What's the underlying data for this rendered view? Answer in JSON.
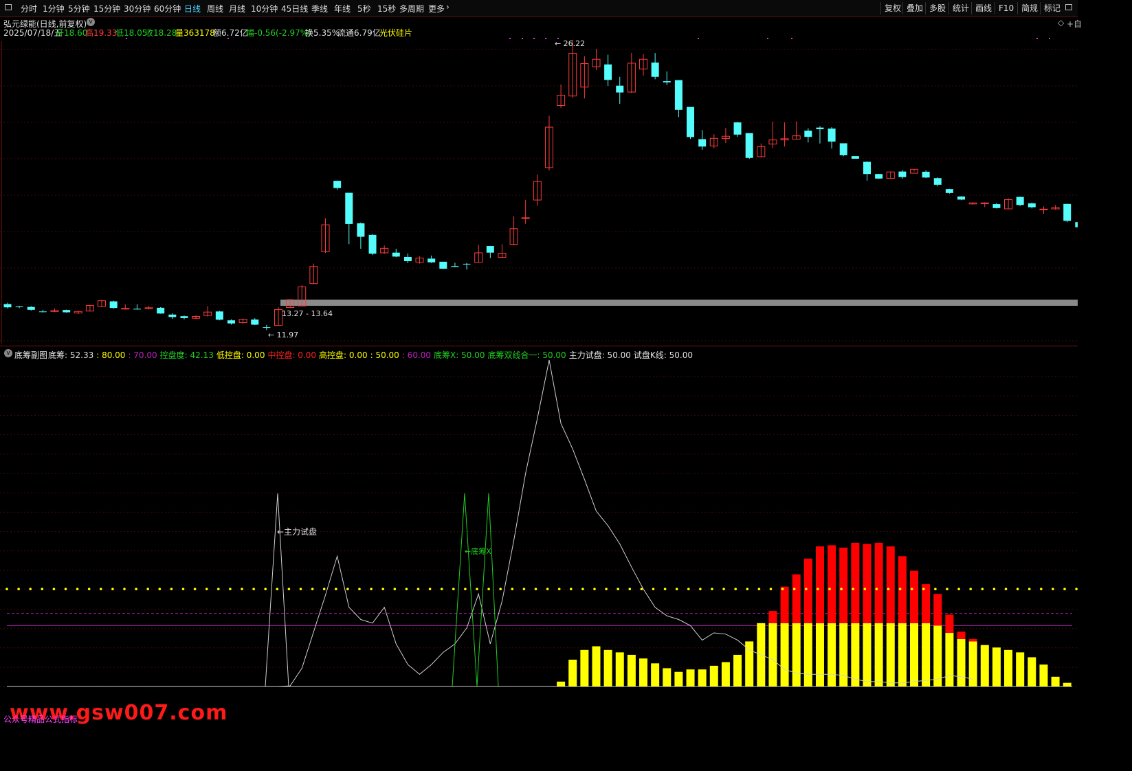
{
  "toolbar": {
    "periods": [
      "分时",
      "1分钟",
      "5分钟",
      "15分钟",
      "30分钟",
      "60分钟",
      "日线",
      "周线",
      "月线",
      "10分钟",
      "45日线",
      "季线",
      "年线",
      "5秒",
      "15秒",
      "多周期",
      "更多"
    ],
    "active_period": "日线",
    "right_buttons": [
      "复权",
      "叠加",
      "多股",
      "统计",
      "画线",
      "F10",
      "简规",
      "标记"
    ]
  },
  "stock": {
    "title": "弘元绿能(日线,前复权)",
    "date": "2025/07/18/五",
    "open": "开18.60",
    "high": "高19.33",
    "low": "低18.05",
    "close": "收18.28",
    "volume": "量363178",
    "amount": "额6.72亿",
    "change": "幅-0.56(-2.97%)",
    "turnover": "换5.35%",
    "float_cap": "流通6.79亿",
    "sector": "光伏硅片",
    "corner": "+自"
  },
  "price_annotations": {
    "max_label": "26.22",
    "min_label": "11.97",
    "range_label": "13.27 - 13.64"
  },
  "indicator": {
    "name": "底筹副图",
    "items": [
      {
        "text": "底筹: 52.33",
        "color": "#e0e0e0"
      },
      {
        "text": ": 80.00",
        "color": "#ffff00"
      },
      {
        "text": ": 70.00",
        "color": "#c020c0"
      },
      {
        "text": "控盘度: 42.13",
        "color": "#20d020"
      },
      {
        "text": "低控盘: 0.00",
        "color": "#ffff00"
      },
      {
        "text": "中控盘: 0.00",
        "color": "#ff2020"
      },
      {
        "text": "高控盘: 0.00",
        "color": "#ffff00"
      },
      {
        "text": ": 50.00",
        "color": "#ffff00"
      },
      {
        "text": ": 60.00",
        "color": "#c020c0"
      },
      {
        "text": "底筹X: 50.00",
        "color": "#20d020"
      },
      {
        "text": "底筹双线合一: 50.00",
        "color": "#20d020"
      },
      {
        "text": "主力试盘: 50.00",
        "color": "#e0e0e0"
      },
      {
        "text": "试盘K线: 50.00",
        "color": "#e0e0e0"
      }
    ],
    "label_zhuli": "主力试盘",
    "label_dichou": "底筹X"
  },
  "colors": {
    "up": "#ff3c3c",
    "down": "#54fcfc",
    "volume_yellow": "#ffff00",
    "volume_red": "#ff0000",
    "line_white": "#d0d0d0",
    "line_green": "#20d020",
    "dots_yellow": "#ffff00",
    "level_magenta": "#a020a0"
  },
  "watermark": {
    "url": "www.gsw007.com",
    "text": "公众号精品公式指标"
  },
  "chart_data": {
    "type": "candlestick",
    "candles": [
      {
        "o": 13.42,
        "h": 13.48,
        "l": 13.21,
        "c": 13.26
      },
      {
        "o": 13.3,
        "h": 13.33,
        "l": 13.22,
        "c": 13.28
      },
      {
        "o": 13.28,
        "h": 13.32,
        "l": 13.1,
        "c": 13.14
      },
      {
        "o": 13.06,
        "h": 13.14,
        "l": 13.01,
        "c": 13.04
      },
      {
        "o": 13.06,
        "h": 13.21,
        "l": 13.02,
        "c": 13.1
      },
      {
        "o": 13.13,
        "h": 13.15,
        "l": 13.0,
        "c": 13.02
      },
      {
        "o": 12.99,
        "h": 13.1,
        "l": 12.93,
        "c": 13.06
      },
      {
        "o": 13.08,
        "h": 13.37,
        "l": 13.06,
        "c": 13.35
      },
      {
        "o": 13.3,
        "h": 13.62,
        "l": 13.28,
        "c": 13.58
      },
      {
        "o": 13.55,
        "h": 13.58,
        "l": 13.2,
        "c": 13.23
      },
      {
        "o": 13.19,
        "h": 13.4,
        "l": 13.16,
        "c": 13.21
      },
      {
        "o": 13.19,
        "h": 13.4,
        "l": 13.15,
        "c": 13.18
      },
      {
        "o": 13.21,
        "h": 13.33,
        "l": 13.16,
        "c": 13.24
      },
      {
        "o": 13.24,
        "h": 13.27,
        "l": 12.95,
        "c": 12.96
      },
      {
        "o": 12.91,
        "h": 12.97,
        "l": 12.7,
        "c": 12.79
      },
      {
        "o": 12.83,
        "h": 12.86,
        "l": 12.68,
        "c": 12.74
      },
      {
        "o": 12.73,
        "h": 12.88,
        "l": 12.68,
        "c": 12.82
      },
      {
        "o": 12.87,
        "h": 13.32,
        "l": 12.81,
        "c": 13.03
      },
      {
        "o": 13.06,
        "h": 13.09,
        "l": 12.63,
        "c": 12.66
      },
      {
        "o": 12.63,
        "h": 12.68,
        "l": 12.42,
        "c": 12.48
      },
      {
        "o": 12.52,
        "h": 12.72,
        "l": 12.45,
        "c": 12.68
      },
      {
        "o": 12.67,
        "h": 12.73,
        "l": 12.4,
        "c": 12.42
      },
      {
        "o": 12.3,
        "h": 12.41,
        "l": 12.16,
        "c": 12.28
      },
      {
        "o": 12.38,
        "h": 13.26,
        "l": 12.37,
        "c": 13.15
      },
      {
        "o": 13.25,
        "h": 13.66,
        "l": 13.24,
        "c": 13.63
      },
      {
        "o": 13.33,
        "h": 14.33,
        "l": 13.31,
        "c": 14.25
      },
      {
        "o": 14.41,
        "h": 15.38,
        "l": 14.39,
        "c": 15.24
      },
      {
        "o": 15.96,
        "h": 17.58,
        "l": 15.89,
        "c": 17.26
      },
      {
        "o": 19.39,
        "h": 19.4,
        "l": 18.96,
        "c": 19.04
      },
      {
        "o": 18.81,
        "h": 18.8,
        "l": 16.32,
        "c": 17.3
      },
      {
        "o": 17.33,
        "h": 17.37,
        "l": 16.1,
        "c": 16.68
      },
      {
        "o": 16.77,
        "h": 16.81,
        "l": 15.79,
        "c": 15.86
      },
      {
        "o": 15.9,
        "h": 16.26,
        "l": 15.85,
        "c": 16.12
      },
      {
        "o": 15.91,
        "h": 16.1,
        "l": 15.69,
        "c": 15.72
      },
      {
        "o": 15.7,
        "h": 15.87,
        "l": 15.4,
        "c": 15.5
      },
      {
        "o": 15.45,
        "h": 15.74,
        "l": 15.38,
        "c": 15.65
      },
      {
        "o": 15.62,
        "h": 15.77,
        "l": 15.41,
        "c": 15.44
      },
      {
        "o": 15.47,
        "h": 15.46,
        "l": 15.11,
        "c": 15.13
      },
      {
        "o": 15.26,
        "h": 15.42,
        "l": 15.21,
        "c": 15.22
      },
      {
        "o": 15.37,
        "h": 15.41,
        "l": 15.09,
        "c": 15.34
      },
      {
        "o": 15.44,
        "h": 16.3,
        "l": 15.44,
        "c": 15.9
      },
      {
        "o": 16.23,
        "h": 16.24,
        "l": 15.65,
        "c": 15.91
      },
      {
        "o": 15.68,
        "h": 16.32,
        "l": 15.68,
        "c": 15.88
      },
      {
        "o": 16.31,
        "h": 17.67,
        "l": 16.27,
        "c": 17.07
      },
      {
        "o": 17.57,
        "h": 18.47,
        "l": 17.3,
        "c": 17.6
      },
      {
        "o": 18.46,
        "h": 19.7,
        "l": 18.18,
        "c": 19.36
      },
      {
        "o": 20.03,
        "h": 22.54,
        "l": 19.89,
        "c": 21.99
      },
      {
        "o": 23.04,
        "h": 24.06,
        "l": 22.92,
        "c": 23.54
      },
      {
        "o": 23.5,
        "h": 26.22,
        "l": 23.41,
        "c": 25.57
      },
      {
        "o": 23.93,
        "h": 25.43,
        "l": 23.38,
        "c": 25.07
      },
      {
        "o": 24.92,
        "h": 25.79,
        "l": 24.75,
        "c": 25.28
      },
      {
        "o": 25.03,
        "h": 25.5,
        "l": 23.99,
        "c": 24.28
      },
      {
        "o": 24.0,
        "h": 24.43,
        "l": 23.12,
        "c": 23.67
      },
      {
        "o": 23.69,
        "h": 25.59,
        "l": 23.64,
        "c": 25.09
      },
      {
        "o": 24.81,
        "h": 25.53,
        "l": 24.49,
        "c": 25.28
      },
      {
        "o": 25.12,
        "h": 25.58,
        "l": 24.31,
        "c": 24.43
      },
      {
        "o": 24.22,
        "h": 24.69,
        "l": 24.03,
        "c": 24.16
      },
      {
        "o": 24.27,
        "h": 24.26,
        "l": 22.48,
        "c": 22.83
      },
      {
        "o": 22.97,
        "h": 22.96,
        "l": 21.42,
        "c": 21.51
      },
      {
        "o": 21.41,
        "h": 21.85,
        "l": 20.89,
        "c": 21.05
      },
      {
        "o": 21.08,
        "h": 21.65,
        "l": 20.97,
        "c": 21.45
      },
      {
        "o": 21.44,
        "h": 21.95,
        "l": 21.22,
        "c": 21.55
      },
      {
        "o": 22.22,
        "h": 22.25,
        "l": 21.52,
        "c": 21.63
      },
      {
        "o": 21.7,
        "h": 21.65,
        "l": 20.45,
        "c": 20.5
      },
      {
        "o": 20.56,
        "h": 21.2,
        "l": 20.52,
        "c": 21.05
      },
      {
        "o": 21.17,
        "h": 22.26,
        "l": 20.97,
        "c": 21.37
      },
      {
        "o": 21.37,
        "h": 22.22,
        "l": 21.05,
        "c": 21.43
      },
      {
        "o": 21.41,
        "h": 22.27,
        "l": 21.39,
        "c": 21.57
      },
      {
        "o": 21.82,
        "h": 21.94,
        "l": 21.25,
        "c": 21.52
      },
      {
        "o": 21.97,
        "h": 22.04,
        "l": 21.2,
        "c": 21.89
      },
      {
        "o": 21.92,
        "h": 21.99,
        "l": 20.95,
        "c": 21.29
      },
      {
        "o": 21.21,
        "h": 21.07,
        "l": 20.58,
        "c": 20.63
      },
      {
        "o": 20.59,
        "h": 20.46,
        "l": 20.46,
        "c": 20.46
      },
      {
        "o": 20.31,
        "h": 20.33,
        "l": 19.4,
        "c": 19.72
      },
      {
        "o": 19.72,
        "h": 19.73,
        "l": 19.48,
        "c": 19.5
      },
      {
        "o": 19.51,
        "h": 19.84,
        "l": 19.51,
        "c": 19.82
      },
      {
        "o": 19.84,
        "h": 19.91,
        "l": 19.49,
        "c": 19.57
      },
      {
        "o": 19.76,
        "h": 19.95,
        "l": 19.84,
        "c": 19.95
      },
      {
        "o": 19.83,
        "h": 19.9,
        "l": 19.53,
        "c": 19.55
      },
      {
        "o": 19.52,
        "h": 19.56,
        "l": 19.12,
        "c": 19.2
      },
      {
        "o": 18.99,
        "h": 19.0,
        "l": 18.77,
        "c": 18.8
      },
      {
        "o": 18.63,
        "h": 18.65,
        "l": 18.45,
        "c": 18.48
      },
      {
        "o": 18.27,
        "h": 18.35,
        "l": 18.24,
        "c": 18.32
      },
      {
        "o": 18.28,
        "h": 18.35,
        "l": 18.12,
        "c": 18.32
      },
      {
        "o": 18.26,
        "h": 18.31,
        "l": 18.05,
        "c": 18.07
      },
      {
        "o": 18.03,
        "h": 18.54,
        "l": 18.04,
        "c": 18.48
      },
      {
        "o": 18.61,
        "h": 18.63,
        "l": 18.17,
        "c": 18.22
      },
      {
        "o": 18.3,
        "h": 18.34,
        "l": 18.05,
        "c": 18.11
      },
      {
        "o": 18.02,
        "h": 18.15,
        "l": 17.79,
        "c": 18.02
      },
      {
        "o": 18.03,
        "h": 18.21,
        "l": 17.99,
        "c": 18.09
      },
      {
        "o": 18.27,
        "h": 18.28,
        "l": 17.39,
        "c": 17.45
      },
      {
        "o": 17.39,
        "h": 17.47,
        "l": 16.96,
        "c": 17.14
      },
      {
        "o": 17.15,
        "h": 17.09,
        "l": 16.64,
        "c": 16.68
      },
      {
        "o": 16.67,
        "h": 16.97,
        "l": 16.58,
        "c": 16.88
      },
      {
        "o": 18.6,
        "h": 19.33,
        "l": 18.05,
        "c": 18.28
      }
    ],
    "oscillator": {
      "line_white": [
        0,
        0,
        0,
        0,
        0,
        0,
        0,
        0,
        0,
        0,
        0,
        0,
        0,
        0,
        0,
        0,
        0,
        0,
        0,
        0,
        0,
        0,
        0,
        0,
        0.5,
        15,
        45,
        75,
        107,
        65,
        55,
        52,
        65,
        35,
        18,
        10,
        18,
        28,
        35,
        48,
        76,
        35,
        70,
        120,
        175,
        220,
        268,
        216,
        195,
        170,
        144,
        132,
        117,
        98,
        80,
        65,
        58,
        55,
        50,
        38,
        44,
        43,
        38,
        30,
        26,
        22,
        14,
        11,
        10,
        10,
        10,
        9,
        6,
        4,
        4,
        3,
        3,
        4,
        5,
        6,
        9,
        8,
        6
      ],
      "bars_yellow": [
        0,
        0,
        0,
        0,
        0,
        0,
        0,
        0,
        0,
        0,
        0,
        0,
        0,
        0,
        0,
        0,
        0,
        0,
        0,
        0,
        0,
        0,
        0,
        0,
        0,
        0,
        0,
        4,
        22,
        30,
        33,
        30,
        28,
        26,
        23,
        19,
        15,
        12,
        14,
        14,
        17,
        20,
        26,
        37,
        52,
        52,
        52,
        52,
        52,
        52,
        52,
        52,
        52,
        52,
        52,
        52,
        52,
        52,
        52,
        50,
        44,
        39,
        37,
        34,
        32,
        30,
        28,
        24,
        18,
        8,
        3
      ],
      "bars_red_above_52": [
        0,
        0,
        0,
        0,
        0,
        0,
        0,
        0,
        0,
        0,
        0,
        0,
        0,
        0,
        0,
        0,
        0,
        0,
        0,
        0,
        0,
        0,
        0,
        0,
        0,
        0,
        0,
        0,
        0,
        0,
        0,
        0,
        0,
        0,
        0,
        0,
        0,
        0,
        0,
        0,
        0,
        0,
        0,
        0,
        0,
        10,
        30,
        40,
        53,
        63,
        64,
        62,
        66,
        65,
        66,
        63,
        55,
        43,
        32,
        26,
        15,
        6,
        2
      ],
      "green_spikes_index": [
        38,
        39,
        40,
        41,
        42,
        43
      ],
      "dotted_level": 80,
      "magenta_dashed_level": 60,
      "magenta_solid_level": 50,
      "baseline": 0
    }
  }
}
